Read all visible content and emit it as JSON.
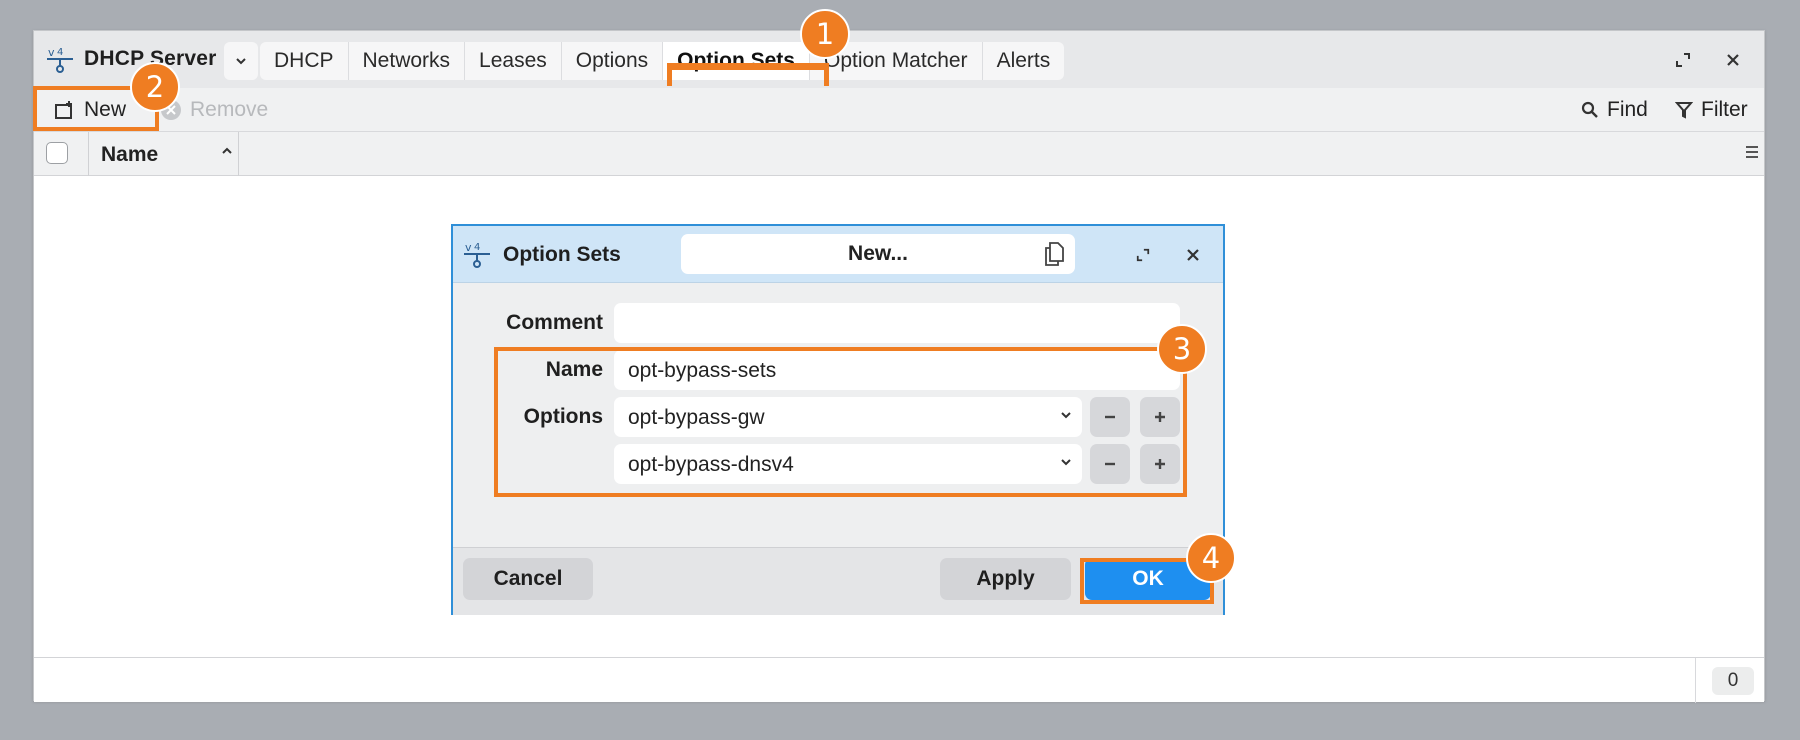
{
  "app": {
    "title": "DHCP Server",
    "tabs": [
      "DHCP",
      "Networks",
      "Leases",
      "Options",
      "Option Sets",
      "Option Matcher",
      "Alerts"
    ],
    "active_tab": "Option Sets",
    "icon": "router-icon"
  },
  "toolbar": {
    "new_label": "New",
    "remove_label": "Remove",
    "find_label": "Find",
    "filter_label": "Filter"
  },
  "table": {
    "columns": [
      "Name"
    ],
    "sort": "ascending",
    "rows": []
  },
  "status": {
    "count": "0"
  },
  "dialog": {
    "title": "Option Sets",
    "name_header": "New...",
    "labels": {
      "comment": "Comment",
      "name": "Name",
      "options": "Options"
    },
    "fields": {
      "comment_value": "",
      "name_value": "opt-bypass-sets",
      "options": [
        "opt-bypass-gw",
        "opt-bypass-dnsv4"
      ]
    },
    "buttons": {
      "cancel": "Cancel",
      "apply": "Apply",
      "ok": "OK"
    }
  },
  "annotations": [
    "1",
    "2",
    "3",
    "4"
  ],
  "colors": {
    "accent": "#ef7d22",
    "primary_button": "#1e8ff0",
    "dialog_header": "#cfe5f7",
    "dialog_border": "#2f8fd8"
  }
}
